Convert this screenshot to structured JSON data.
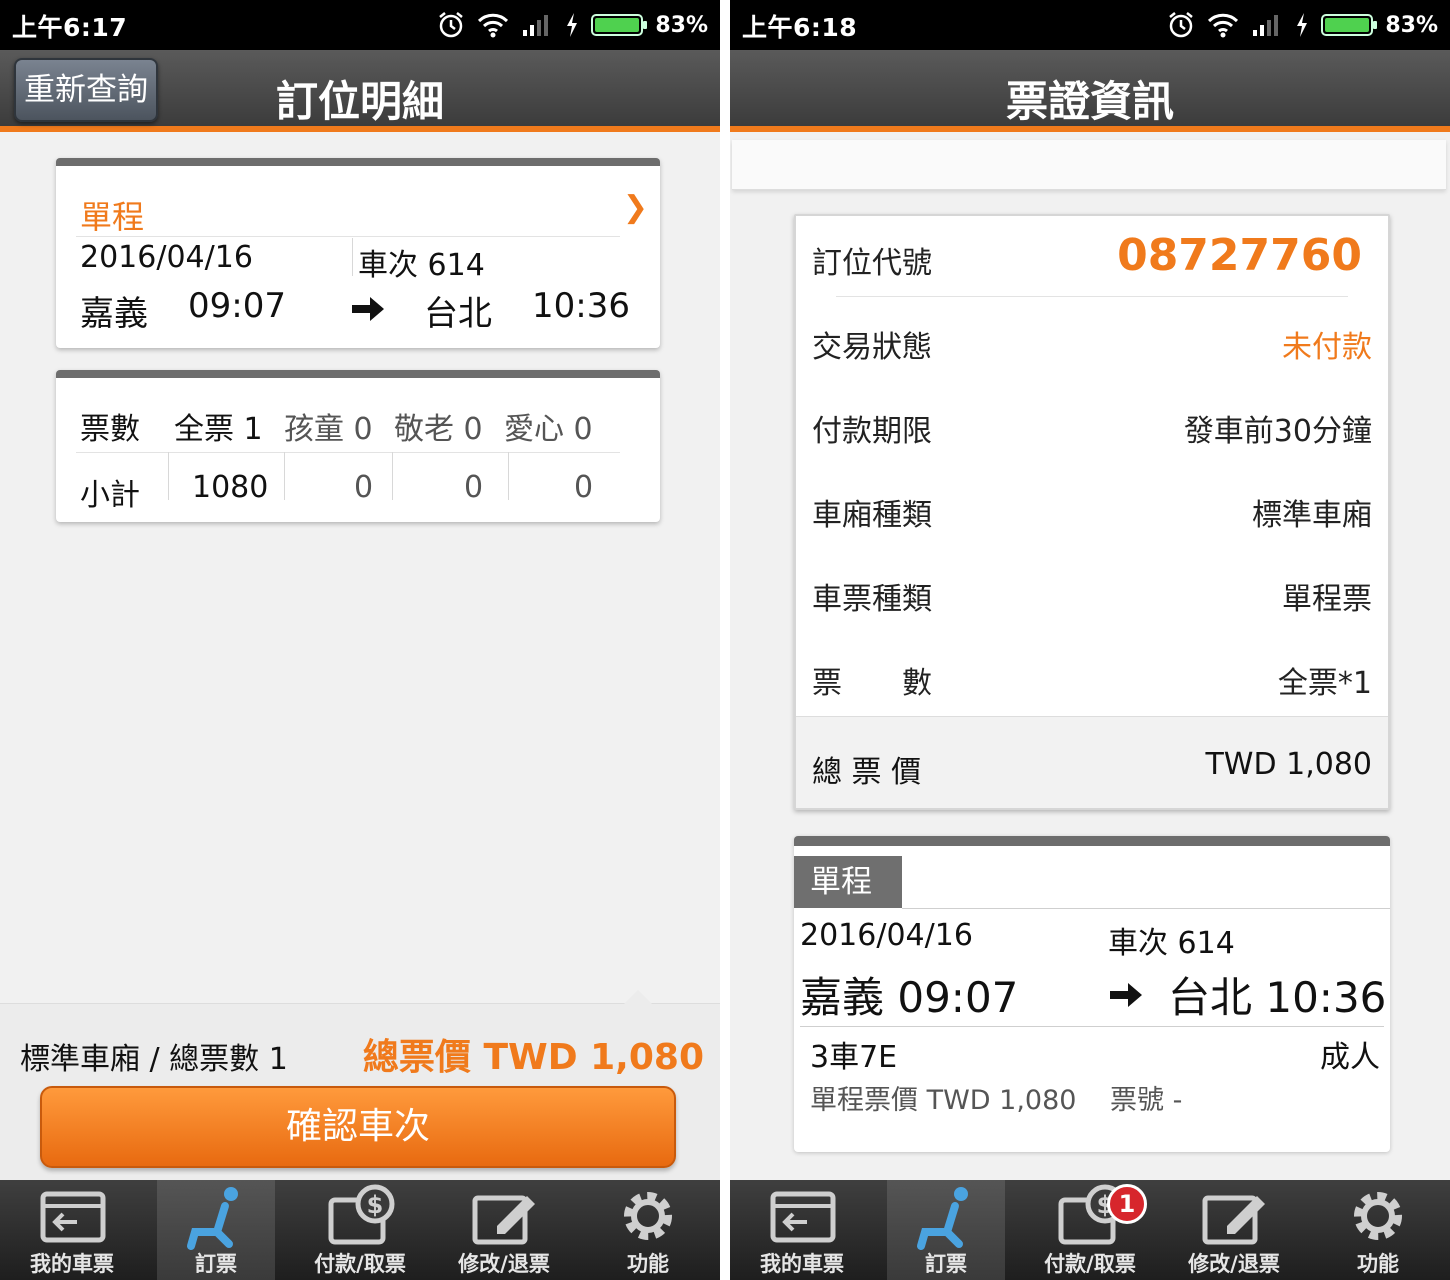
{
  "status_left": {
    "time": "上午6:17",
    "battery": "83%"
  },
  "status_right": {
    "time": "上午6:18",
    "battery": "83%"
  },
  "left": {
    "header": {
      "title": "訂位明細",
      "back_button": "重新查詢"
    },
    "trip": {
      "type": "單程",
      "date": "2016/04/16",
      "train": "車次 614",
      "from_station": "嘉義",
      "depart_time": "09:07",
      "to_station": "台北",
      "arrive_time": "10:36"
    },
    "tickets": {
      "label": "票數",
      "full": "全票 1",
      "child": "孩童 0",
      "senior": "敬老 0",
      "love": "愛心 0",
      "subtotal_label": "小計",
      "subtotal_full": "1080",
      "subtotal_child": "0",
      "subtotal_senior": "0",
      "subtotal_love": "0"
    },
    "footer": {
      "summary": "標準車廂 / 總票數 1",
      "total": "總票價 TWD 1,080",
      "confirm": "確認車次"
    }
  },
  "right": {
    "header": {
      "title": "票證資訊"
    },
    "info": {
      "booking_code_label": "訂位代號",
      "booking_code": "08727760",
      "status_label": "交易狀態",
      "status": "未付款",
      "deadline_label": "付款期限",
      "deadline": "發車前30分鐘",
      "car_type_label": "車廂種類",
      "car_type": "標準車廂",
      "ticket_type_label": "車票種類",
      "ticket_type": "單程票",
      "count_label": "票　　數",
      "count": "全票*1",
      "total_label": "總 票 價",
      "total": "TWD 1,080"
    },
    "route": {
      "tag": "單程",
      "date": "2016/04/16",
      "train": "車次 614",
      "depart": "嘉義 09:07",
      "arrive": "台北 10:36",
      "seat": "3車7E",
      "passenger": "成人",
      "fare": "單程票價 TWD 1,080",
      "ticket_no": "票號 -"
    }
  },
  "tabs": [
    {
      "label": "我的車票",
      "icon": "ticket-icon"
    },
    {
      "label": "訂票",
      "icon": "seat-icon"
    },
    {
      "label": "付款/取票",
      "icon": "payment-icon"
    },
    {
      "label": "修改/退票",
      "icon": "edit-icon"
    },
    {
      "label": "功能",
      "icon": "gear-icon"
    }
  ],
  "tab_badge": "1",
  "colors": {
    "accent": "#f07a1c",
    "header": "#4a4a4a",
    "badge": "#d7262c"
  }
}
